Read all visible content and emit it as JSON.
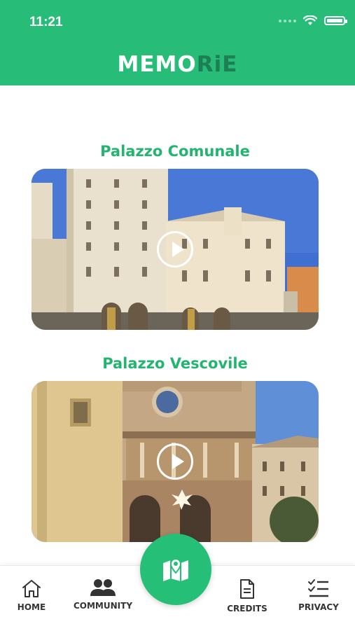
{
  "status_bar": {
    "time": "11:21",
    "wifi_icon": "wifi-icon",
    "battery_icon": "battery-icon",
    "battery_level": 1.0
  },
  "header": {
    "logo_part1": "MEMO",
    "logo_part2": "RiE",
    "logo_colors": {
      "primary": "#ffffff",
      "accent": "#1e7f55"
    }
  },
  "colors": {
    "brand": "#27bd78",
    "title": "#22b56f"
  },
  "places": [
    {
      "title": "Palazzo Comunale",
      "play_icon": "play-icon"
    },
    {
      "title": "Palazzo Vescovile",
      "play_icon": "play-icon"
    }
  ],
  "tabbar": {
    "home_label": "HOME",
    "community_label": "COMMUNITY",
    "credits_label": "CREDITS",
    "privacy_label": "PRIVACY",
    "map_icon": "map-pin-icon"
  }
}
